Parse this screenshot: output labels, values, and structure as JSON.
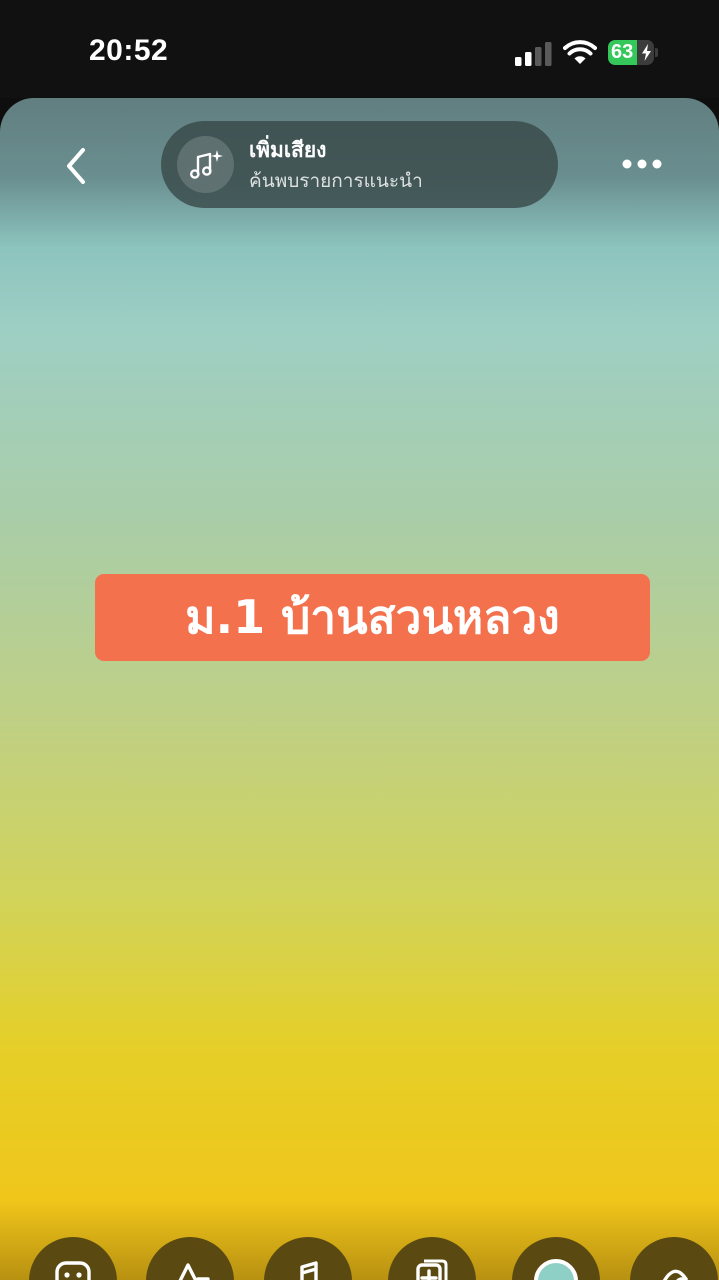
{
  "status_bar": {
    "time": "20:52",
    "battery_percent": "63",
    "battery_level": 0.63,
    "icons": [
      "cellular-signal-icon",
      "wifi-icon",
      "battery-charging-icon"
    ]
  },
  "story": {
    "music_sticker": {
      "title": "เพิ่มเสียง",
      "subtitle": "ค้นพบรายการแนะนำ",
      "icon": "music-note-sparkle-icon"
    },
    "caption": "ม.1 บ้านสวนหลวง",
    "caption_color": "#f4714d",
    "background_colors": [
      "#617e80",
      "#9ecfc4",
      "#c9d170",
      "#f4c21b"
    ]
  },
  "toolbar": {
    "tools": [
      "sticker-icon",
      "text-icon",
      "music-icon",
      "add-clip-icon",
      "effects-icon",
      "draw-icon"
    ]
  }
}
